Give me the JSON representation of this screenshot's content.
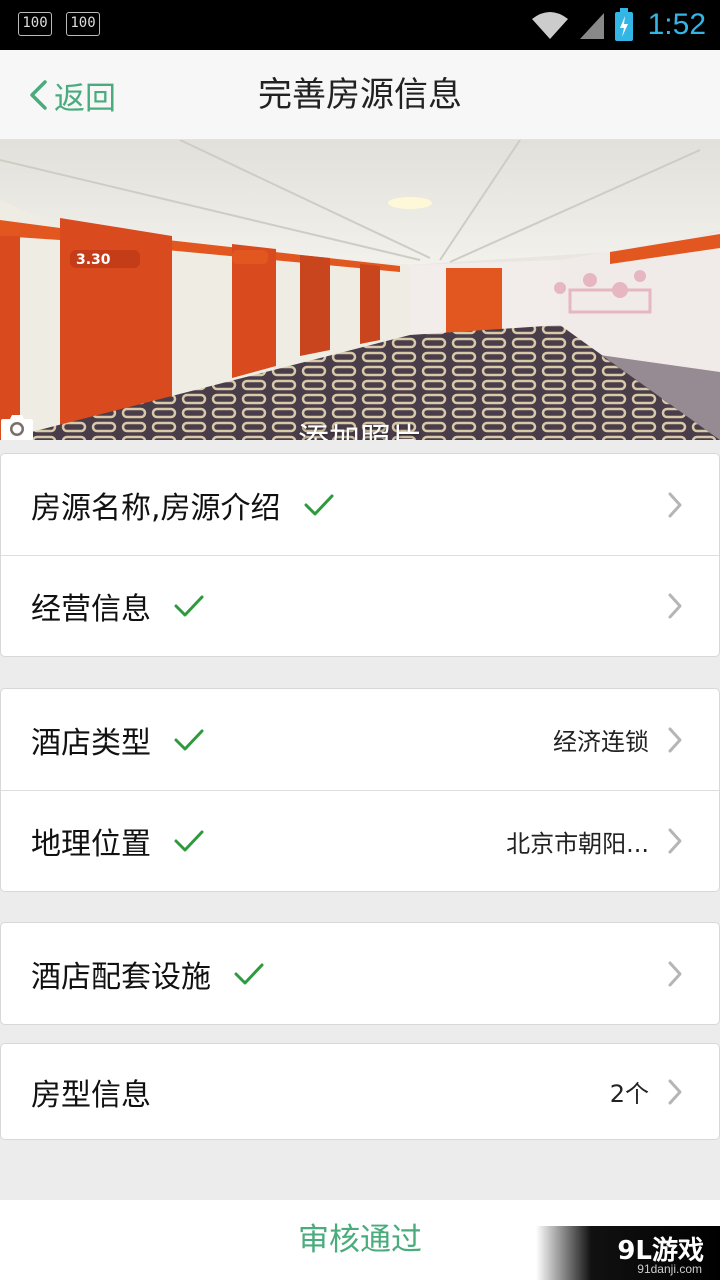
{
  "statusbar": {
    "badge_left": "100",
    "badge_right": "100",
    "time": "1:52"
  },
  "header": {
    "back_label": "返回",
    "title": "完善房源信息"
  },
  "hero": {
    "add_photo_label": "添加照片"
  },
  "groups": [
    {
      "rows": [
        {
          "label": "房源名称,房源介绍",
          "checked": true,
          "value": ""
        },
        {
          "label": "经营信息",
          "checked": true,
          "value": ""
        }
      ]
    },
    {
      "rows": [
        {
          "label": "酒店类型",
          "checked": true,
          "value": "经济连锁"
        },
        {
          "label": "地理位置",
          "checked": true,
          "value": "北京市朝阳..."
        }
      ]
    },
    {
      "rows": [
        {
          "label": "酒店配套设施",
          "checked": true,
          "value": ""
        }
      ]
    },
    {
      "rows": [
        {
          "label": "房型信息",
          "checked": false,
          "value": "2个"
        }
      ]
    }
  ],
  "footer": {
    "submit_label": "审核通过",
    "watermark_brand": "9L游戏",
    "watermark_url": "91danji.com"
  },
  "colors": {
    "accent": "#4aab7d",
    "check": "#2e9a3e",
    "status_time": "#33b5e5"
  }
}
